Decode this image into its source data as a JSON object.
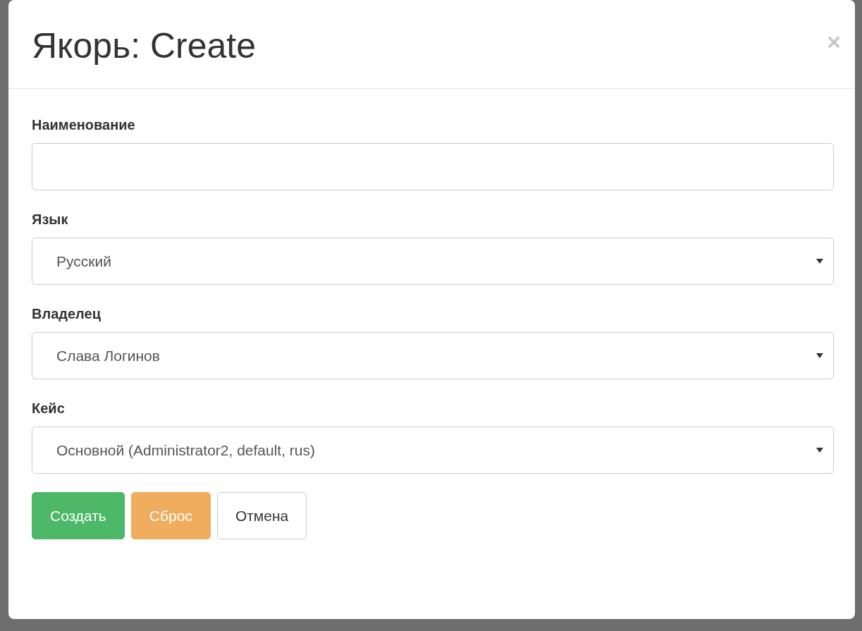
{
  "dialog": {
    "title": "Якорь: Create",
    "close": "×",
    "fields": [
      {
        "kind": "text",
        "label": "Наименование"
      },
      {
        "kind": "select",
        "label": "Язык",
        "value": "Русский"
      },
      {
        "kind": "select",
        "label": "Владелец",
        "value": "Слава Логинов"
      },
      {
        "kind": "select",
        "label": "Кейс",
        "value": "Основной (Administrator2, default, rus)"
      }
    ],
    "buttons": [
      {
        "kind": "success",
        "label": "Создать"
      },
      {
        "kind": "warning",
        "label": "Сброс"
      },
      {
        "kind": "default",
        "label": "Отмена"
      }
    ]
  }
}
